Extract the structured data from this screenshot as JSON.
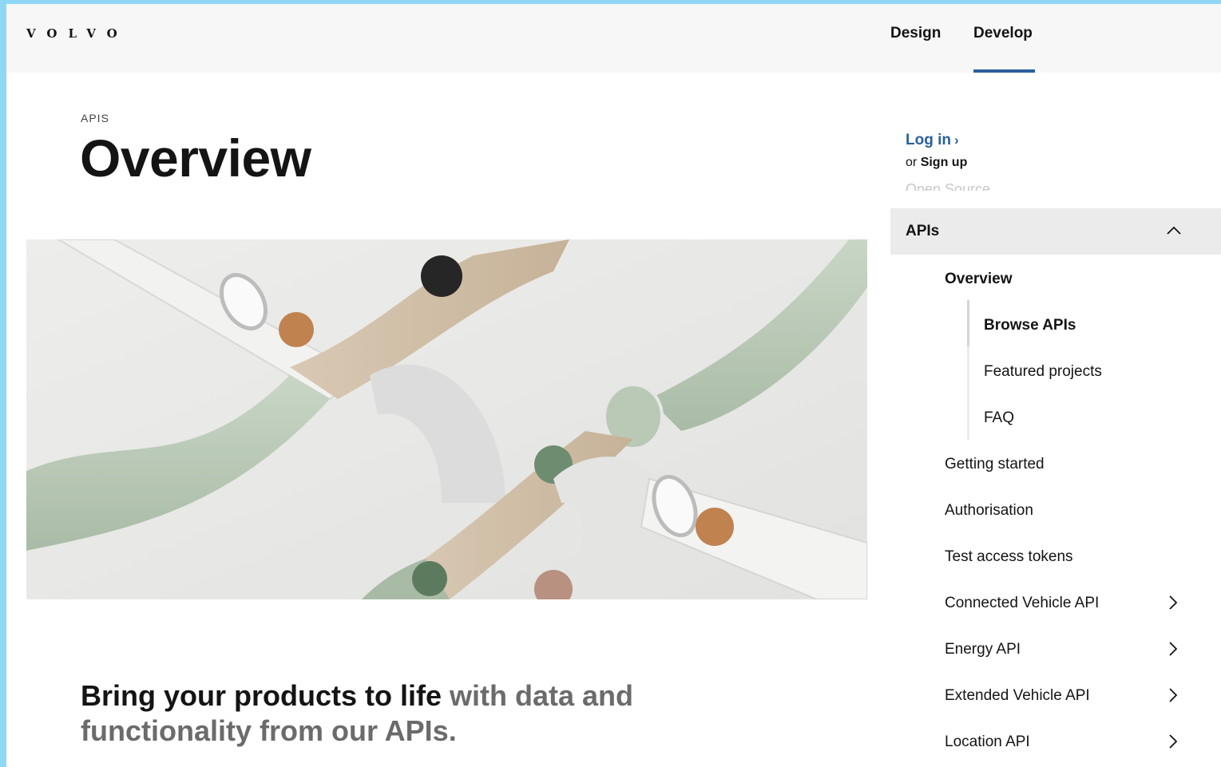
{
  "header": {
    "logo": "VOLVO",
    "nav": [
      {
        "label": "Design",
        "active": false
      },
      {
        "label": "Develop",
        "active": true
      }
    ],
    "accent_color": "#2a609d"
  },
  "main": {
    "eyebrow": "APIS",
    "title": "Overview",
    "hero_image": "abstract-tubes-illustration",
    "lead_strong": "Bring your products to life",
    "lead_muted": " with data and functionality from our APIs."
  },
  "sidebar": {
    "login_label": "Log in",
    "or_text": "or",
    "signup_label": "Sign up",
    "faded_item": "Open Source",
    "section_label": "APIs",
    "items": [
      {
        "label": "Overview",
        "level": 1,
        "bold": true
      },
      {
        "label": "Browse APIs",
        "level": 2,
        "bold": true,
        "active": true
      },
      {
        "label": "Featured projects",
        "level": 2
      },
      {
        "label": "FAQ",
        "level": 2
      },
      {
        "label": "Getting started",
        "level": 1
      },
      {
        "label": "Authorisation",
        "level": 1
      },
      {
        "label": "Test access tokens",
        "level": 1
      },
      {
        "label": "Connected Vehicle API",
        "level": 1,
        "expandable": true
      },
      {
        "label": "Energy API",
        "level": 1,
        "expandable": true
      },
      {
        "label": "Extended Vehicle API",
        "level": 1,
        "expandable": true
      },
      {
        "label": "Location API",
        "level": 1,
        "expandable": true
      }
    ]
  }
}
